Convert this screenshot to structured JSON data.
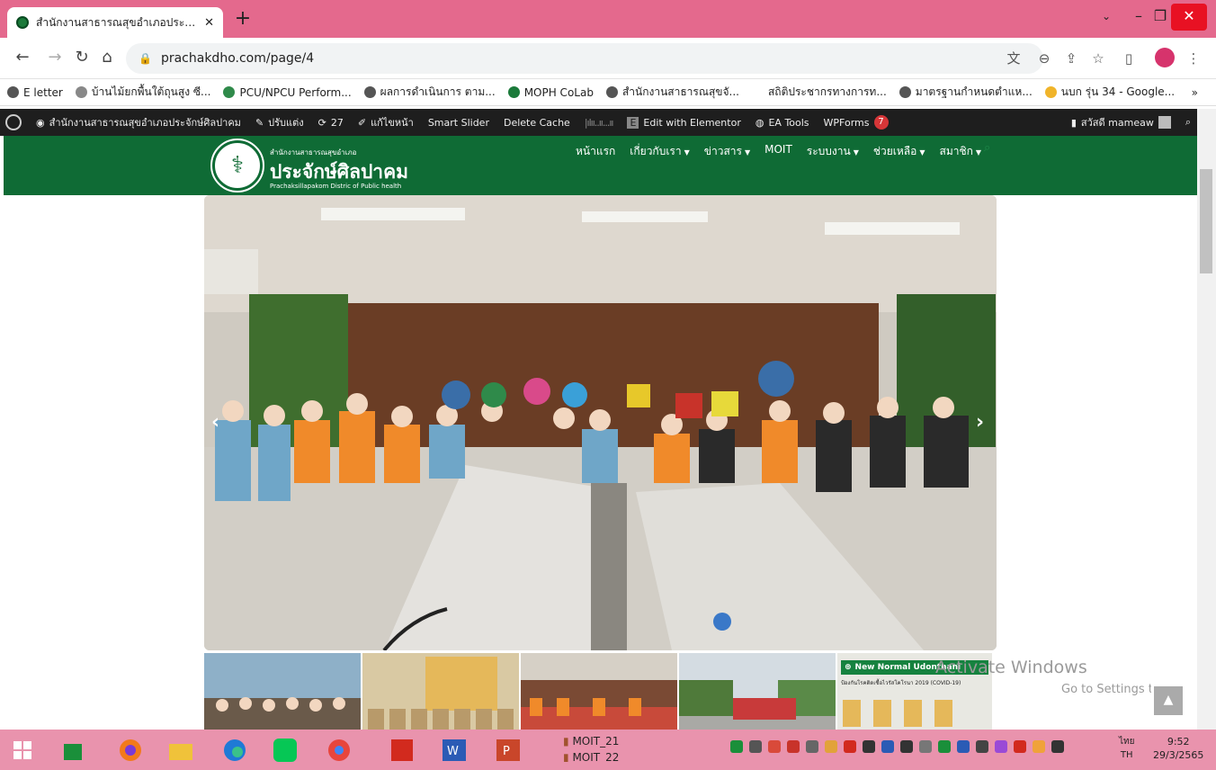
{
  "browser": {
    "tab_title": "สำนักงานสาธารณสุขอำเภอประจักษ์ศิล",
    "url": "prachakdho.com/page/4",
    "bookmarks": [
      "E letter",
      "บ้านไม้ยกพื้นใต้ถุนสูง ซี...",
      "PCU/NPCU Perform...",
      "ผลการดำเนินการ ตาม...",
      "MOPH CoLab",
      "สำนักงานสาธารณสุขจั...",
      "สถิติประชากรทางการท...",
      "มาตรฐานกำหนดตำแห...",
      "นบก รุ่น 34 - Google..."
    ],
    "bookmarks_more": "»"
  },
  "adminbar": {
    "site_name": "สำนักงานสาธารณสุขอำเภอประจักษ์ศิลปาคม",
    "customize": "ปรับแต่ง",
    "updates": "27",
    "edit_page": "แก้ไขหน้า",
    "smart_slider": "Smart Slider",
    "delete_cache": "Delete Cache",
    "edit_elementor": "Edit with Elementor",
    "ea_tools": "EA Tools",
    "wpforms": "WPForms",
    "wpforms_badge": "7",
    "greeting": "สวัสดี mameaw"
  },
  "site": {
    "logo_small": "สำนักงานสาธารณสุขอำเภอ",
    "logo_title": "ประจักษ์ศิลปาคม",
    "logo_en": "Prachaksillapakom Distric of Public health",
    "nav": [
      {
        "label": "หน้าแรก",
        "dropdown": false
      },
      {
        "label": "เกี่ยวกับเรา",
        "dropdown": true
      },
      {
        "label": "ข่าวสาร",
        "dropdown": true
      },
      {
        "label": "MOIT",
        "dropdown": false
      },
      {
        "label": "ระบบงาน",
        "dropdown": true
      },
      {
        "label": "ช่วยเหลือ",
        "dropdown": true
      },
      {
        "label": "สมาชิก",
        "dropdown": true
      }
    ],
    "thumb5_title": "New Normal Udonthani",
    "thumb5_sub": "ป้องกันโรคติดเชื้อไวรัสโคโรนา 2019 (COVID-19)"
  },
  "watermark": {
    "line1": "Activate Windows",
    "line2": "Go to Settings to activate Windows."
  },
  "taskbar": {
    "pinned": [
      "start",
      "store",
      "firefox",
      "file-explorer",
      "edge",
      "line",
      "chrome",
      "acrobat",
      "word",
      "powerpoint"
    ],
    "files": [
      "MOIT_21",
      "MOIT_22"
    ],
    "lang_top": "ไทย",
    "lang": "TH",
    "time": "9:52",
    "date": "29/3/2565"
  },
  "colors": {
    "tabstrip": "#e4698d",
    "site_green": "#0f6b35",
    "taskbar": "#e993ad"
  }
}
